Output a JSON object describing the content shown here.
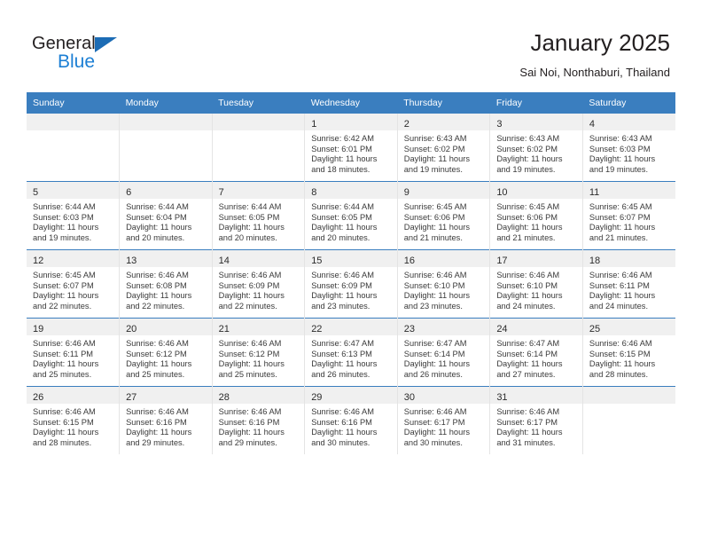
{
  "brand": {
    "name_top": "General",
    "name_bottom": "Blue",
    "triangle_color": "#1c6cb5",
    "blue_color": "#1c7fd4"
  },
  "header": {
    "title": "January 2025",
    "subtitle": "Sai Noi, Nonthaburi, Thailand",
    "header_bg": "#3a7ebf",
    "header_text_color": "#ffffff"
  },
  "weekday_headers": [
    "Sunday",
    "Monday",
    "Tuesday",
    "Wednesday",
    "Thursday",
    "Friday",
    "Saturday"
  ],
  "labels": {
    "sunrise_prefix": "Sunrise:",
    "sunset_prefix": "Sunset:",
    "daylight_prefix": "Daylight:"
  },
  "weeks": [
    [
      {
        "day": "",
        "sunrise": "",
        "sunset": "",
        "daylight_line1": "",
        "daylight_line2": ""
      },
      {
        "day": "",
        "sunrise": "",
        "sunset": "",
        "daylight_line1": "",
        "daylight_line2": ""
      },
      {
        "day": "",
        "sunrise": "",
        "sunset": "",
        "daylight_line1": "",
        "daylight_line2": ""
      },
      {
        "day": "1",
        "sunrise": "Sunrise: 6:42 AM",
        "sunset": "Sunset: 6:01 PM",
        "daylight_line1": "Daylight: 11 hours",
        "daylight_line2": "and 18 minutes."
      },
      {
        "day": "2",
        "sunrise": "Sunrise: 6:43 AM",
        "sunset": "Sunset: 6:02 PM",
        "daylight_line1": "Daylight: 11 hours",
        "daylight_line2": "and 19 minutes."
      },
      {
        "day": "3",
        "sunrise": "Sunrise: 6:43 AM",
        "sunset": "Sunset: 6:02 PM",
        "daylight_line1": "Daylight: 11 hours",
        "daylight_line2": "and 19 minutes."
      },
      {
        "day": "4",
        "sunrise": "Sunrise: 6:43 AM",
        "sunset": "Sunset: 6:03 PM",
        "daylight_line1": "Daylight: 11 hours",
        "daylight_line2": "and 19 minutes."
      }
    ],
    [
      {
        "day": "5",
        "sunrise": "Sunrise: 6:44 AM",
        "sunset": "Sunset: 6:03 PM",
        "daylight_line1": "Daylight: 11 hours",
        "daylight_line2": "and 19 minutes."
      },
      {
        "day": "6",
        "sunrise": "Sunrise: 6:44 AM",
        "sunset": "Sunset: 6:04 PM",
        "daylight_line1": "Daylight: 11 hours",
        "daylight_line2": "and 20 minutes."
      },
      {
        "day": "7",
        "sunrise": "Sunrise: 6:44 AM",
        "sunset": "Sunset: 6:05 PM",
        "daylight_line1": "Daylight: 11 hours",
        "daylight_line2": "and 20 minutes."
      },
      {
        "day": "8",
        "sunrise": "Sunrise: 6:44 AM",
        "sunset": "Sunset: 6:05 PM",
        "daylight_line1": "Daylight: 11 hours",
        "daylight_line2": "and 20 minutes."
      },
      {
        "day": "9",
        "sunrise": "Sunrise: 6:45 AM",
        "sunset": "Sunset: 6:06 PM",
        "daylight_line1": "Daylight: 11 hours",
        "daylight_line2": "and 21 minutes."
      },
      {
        "day": "10",
        "sunrise": "Sunrise: 6:45 AM",
        "sunset": "Sunset: 6:06 PM",
        "daylight_line1": "Daylight: 11 hours",
        "daylight_line2": "and 21 minutes."
      },
      {
        "day": "11",
        "sunrise": "Sunrise: 6:45 AM",
        "sunset": "Sunset: 6:07 PM",
        "daylight_line1": "Daylight: 11 hours",
        "daylight_line2": "and 21 minutes."
      }
    ],
    [
      {
        "day": "12",
        "sunrise": "Sunrise: 6:45 AM",
        "sunset": "Sunset: 6:07 PM",
        "daylight_line1": "Daylight: 11 hours",
        "daylight_line2": "and 22 minutes."
      },
      {
        "day": "13",
        "sunrise": "Sunrise: 6:46 AM",
        "sunset": "Sunset: 6:08 PM",
        "daylight_line1": "Daylight: 11 hours",
        "daylight_line2": "and 22 minutes."
      },
      {
        "day": "14",
        "sunrise": "Sunrise: 6:46 AM",
        "sunset": "Sunset: 6:09 PM",
        "daylight_line1": "Daylight: 11 hours",
        "daylight_line2": "and 22 minutes."
      },
      {
        "day": "15",
        "sunrise": "Sunrise: 6:46 AM",
        "sunset": "Sunset: 6:09 PM",
        "daylight_line1": "Daylight: 11 hours",
        "daylight_line2": "and 23 minutes."
      },
      {
        "day": "16",
        "sunrise": "Sunrise: 6:46 AM",
        "sunset": "Sunset: 6:10 PM",
        "daylight_line1": "Daylight: 11 hours",
        "daylight_line2": "and 23 minutes."
      },
      {
        "day": "17",
        "sunrise": "Sunrise: 6:46 AM",
        "sunset": "Sunset: 6:10 PM",
        "daylight_line1": "Daylight: 11 hours",
        "daylight_line2": "and 24 minutes."
      },
      {
        "day": "18",
        "sunrise": "Sunrise: 6:46 AM",
        "sunset": "Sunset: 6:11 PM",
        "daylight_line1": "Daylight: 11 hours",
        "daylight_line2": "and 24 minutes."
      }
    ],
    [
      {
        "day": "19",
        "sunrise": "Sunrise: 6:46 AM",
        "sunset": "Sunset: 6:11 PM",
        "daylight_line1": "Daylight: 11 hours",
        "daylight_line2": "and 25 minutes."
      },
      {
        "day": "20",
        "sunrise": "Sunrise: 6:46 AM",
        "sunset": "Sunset: 6:12 PM",
        "daylight_line1": "Daylight: 11 hours",
        "daylight_line2": "and 25 minutes."
      },
      {
        "day": "21",
        "sunrise": "Sunrise: 6:46 AM",
        "sunset": "Sunset: 6:12 PM",
        "daylight_line1": "Daylight: 11 hours",
        "daylight_line2": "and 25 minutes."
      },
      {
        "day": "22",
        "sunrise": "Sunrise: 6:47 AM",
        "sunset": "Sunset: 6:13 PM",
        "daylight_line1": "Daylight: 11 hours",
        "daylight_line2": "and 26 minutes."
      },
      {
        "day": "23",
        "sunrise": "Sunrise: 6:47 AM",
        "sunset": "Sunset: 6:14 PM",
        "daylight_line1": "Daylight: 11 hours",
        "daylight_line2": "and 26 minutes."
      },
      {
        "day": "24",
        "sunrise": "Sunrise: 6:47 AM",
        "sunset": "Sunset: 6:14 PM",
        "daylight_line1": "Daylight: 11 hours",
        "daylight_line2": "and 27 minutes."
      },
      {
        "day": "25",
        "sunrise": "Sunrise: 6:46 AM",
        "sunset": "Sunset: 6:15 PM",
        "daylight_line1": "Daylight: 11 hours",
        "daylight_line2": "and 28 minutes."
      }
    ],
    [
      {
        "day": "26",
        "sunrise": "Sunrise: 6:46 AM",
        "sunset": "Sunset: 6:15 PM",
        "daylight_line1": "Daylight: 11 hours",
        "daylight_line2": "and 28 minutes."
      },
      {
        "day": "27",
        "sunrise": "Sunrise: 6:46 AM",
        "sunset": "Sunset: 6:16 PM",
        "daylight_line1": "Daylight: 11 hours",
        "daylight_line2": "and 29 minutes."
      },
      {
        "day": "28",
        "sunrise": "Sunrise: 6:46 AM",
        "sunset": "Sunset: 6:16 PM",
        "daylight_line1": "Daylight: 11 hours",
        "daylight_line2": "and 29 minutes."
      },
      {
        "day": "29",
        "sunrise": "Sunrise: 6:46 AM",
        "sunset": "Sunset: 6:16 PM",
        "daylight_line1": "Daylight: 11 hours",
        "daylight_line2": "and 30 minutes."
      },
      {
        "day": "30",
        "sunrise": "Sunrise: 6:46 AM",
        "sunset": "Sunset: 6:17 PM",
        "daylight_line1": "Daylight: 11 hours",
        "daylight_line2": "and 30 minutes."
      },
      {
        "day": "31",
        "sunrise": "Sunrise: 6:46 AM",
        "sunset": "Sunset: 6:17 PM",
        "daylight_line1": "Daylight: 11 hours",
        "daylight_line2": "and 31 minutes."
      },
      {
        "day": "",
        "sunrise": "",
        "sunset": "",
        "daylight_line1": "",
        "daylight_line2": ""
      }
    ]
  ]
}
